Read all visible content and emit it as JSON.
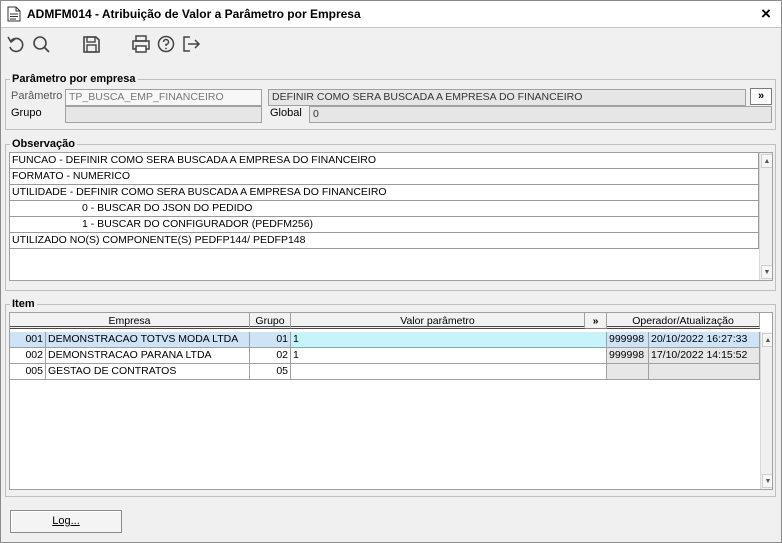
{
  "window": {
    "title": "ADMFM014 - Atribuição de Valor a Parâmetro por Empresa",
    "close_label": "×"
  },
  "toolbar": {
    "icons": [
      "undo-icon",
      "search-icon",
      "save-icon",
      "print-icon",
      "help-icon",
      "exit-icon"
    ]
  },
  "parametro_group": {
    "legend": "Parâmetro por empresa",
    "parametro_label": "Parâmetro",
    "parametro_value": "TP_BUSCA_EMP_FINANCEIRO",
    "descricao_value": "DEFINIR COMO SERA BUSCADA A EMPRESA DO FINANCEIRO",
    "more_label": "»",
    "grupo_label": "Grupo",
    "grupo_value": "",
    "global_label": "Global",
    "global_value": "0"
  },
  "observacao": {
    "legend": "Observação",
    "lines": [
      "FUNCAO - DEFINIR COMO SERA BUSCADA A EMPRESA DO FINANCEIRO",
      "FORMATO - NUMERICO",
      "UTILIDADE - DEFINIR COMO SERA BUSCADA A EMPRESA DO FINANCEIRO",
      "                        0 - BUSCAR DO JSON DO PEDIDO",
      "                        1 - BUSCAR DO CONFIGURADOR (PEDFM256)",
      "UTILIZADO NO(S) COMPONENTE(S) PEDFP144/ PEDFP148"
    ]
  },
  "item": {
    "legend": "Item",
    "headers": {
      "empresa": "Empresa",
      "grupo": "Grupo",
      "valor": "Valor parâmetro",
      "more": "»",
      "operador": "Operador/Atualização"
    },
    "rows": [
      {
        "cod": "001",
        "empresa": "DEMONSTRACAO TOTVS MODA LTDA",
        "grupo": "01",
        "valor": "1",
        "operador": "999998",
        "data": "20/10/2022 16:27:33"
      },
      {
        "cod": "002",
        "empresa": "DEMONSTRACAO PARANA LTDA",
        "grupo": "02",
        "valor": "1",
        "operador": "999998",
        "data": "17/10/2022 14:15:52"
      },
      {
        "cod": "005",
        "empresa": "GESTAO DE CONTRATOS",
        "grupo": "05",
        "valor": "",
        "operador": "",
        "data": ""
      }
    ]
  },
  "footer": {
    "log_label": "Log..."
  },
  "colors": {
    "selected_row": "#cfe3f7",
    "editing_cell": "#c6f4fb",
    "readonly_field": "#e6e6e6"
  }
}
